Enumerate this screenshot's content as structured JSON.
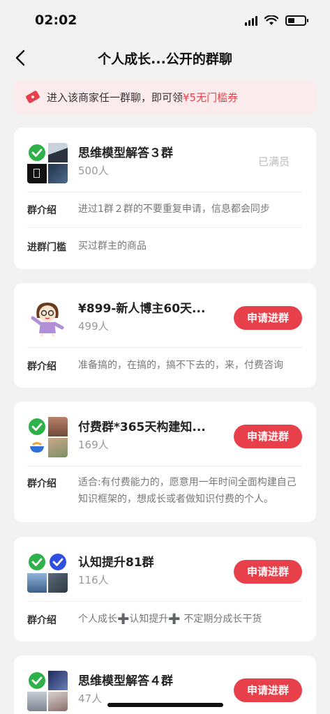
{
  "status": {
    "time": "02:02"
  },
  "nav": {
    "title": "个人成长...公开的群聊"
  },
  "promo": {
    "text_prefix": "进入该商家任一群聊，即可领",
    "highlight": "¥5无门槛券",
    "accent": "#e8404a"
  },
  "join_label": "申请进群",
  "groups": [
    {
      "name": "思维模型解答３群",
      "count": "500人",
      "status_label": "已满员",
      "intro_label": "群介绍",
      "intro": "进过1群２群的不要重复申请，信息都会同步",
      "threshold_label": "进群门槛",
      "threshold": "买过群主的商品"
    },
    {
      "name": "¥899-新人博主60天...",
      "count": "499人",
      "intro_label": "群介绍",
      "intro": "准备搞的，在搞的，搞不下去的，来，付费咨询"
    },
    {
      "name": "付费群*365天构建知...",
      "count": "169人",
      "intro_label": "群介绍",
      "intro": "适合:有付费能力的，愿意用一年时间全面构建自己知识框架的，想成长或者做知识付费的个人。"
    },
    {
      "name": "认知提升81群",
      "count": "116人",
      "intro_label": "群介绍",
      "intro": "个人成长➕认知提升➕ 不定期分成长干货"
    },
    {
      "name": "思维模型解答４群",
      "count": "47人"
    }
  ]
}
